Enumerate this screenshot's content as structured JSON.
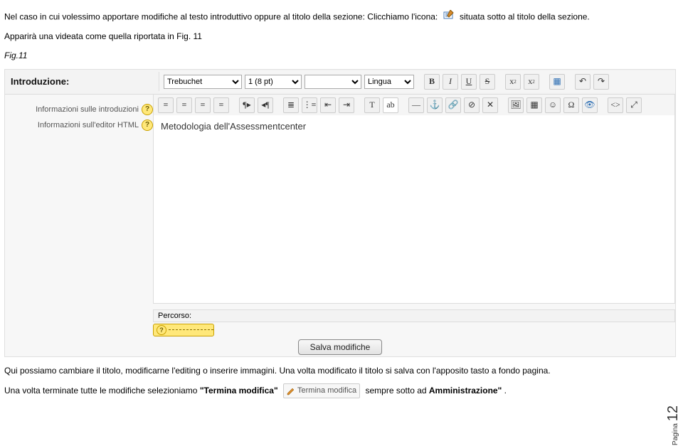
{
  "paragraphs": {
    "p1_a": "Nel caso in cui volessimo apportare modifiche  al testo introduttivo oppure al titolo della sezione: Clicchiamo l'icona:",
    "p1_b": "situata sotto al titolo della sezione.",
    "p2": "Apparirà una videata come quella riportata in Fig. 11",
    "figlabel": "Fig.11",
    "p3_a": "Qui possiamo cambiare il titolo, modificarne l'editing o inserire immagini. Una volta modificato il titolo si salva con l'apposito tasto a fondo pagina.",
    "p4_a": "Una volta terminate tutte le modifiche selezioniamo ",
    "p4_bold1": "\"Termina modifica\"",
    "p4_btn": "Termina modifica",
    "p4_b": " sempre sotto ad ",
    "p4_bold2": "Amministrazione\"",
    "p4_c": "."
  },
  "editor": {
    "label": "Introduzione:",
    "font_family": "Trebuchet",
    "font_size": "1 (8 pt)",
    "lang_label": "Lingua",
    "help1": "Informazioni sulle introduzioni",
    "help2": "Informazioni sull'editor HTML",
    "content": "Metodologia dell'Assessmentcenter",
    "percorso_label": "Percorso:",
    "tooltip": "?",
    "save_label": "Salva modifiche"
  },
  "page_number": {
    "prefix": "Pagina",
    "num": "12"
  }
}
